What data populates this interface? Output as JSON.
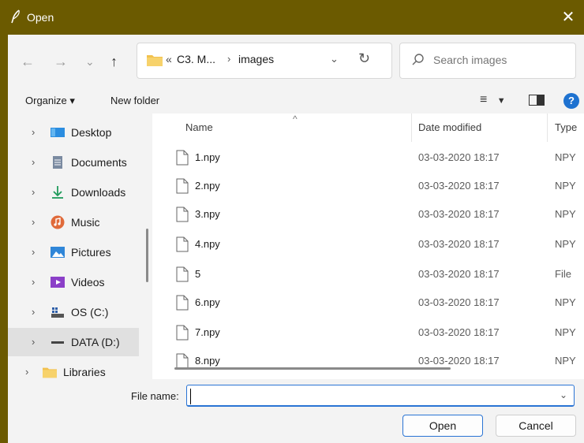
{
  "window": {
    "title": "Open"
  },
  "nav": {
    "back": "←",
    "forward": "→",
    "recent": "⌄",
    "up": "↑"
  },
  "address": {
    "prefix": "«",
    "segments": [
      "C3. M...",
      "images"
    ]
  },
  "search": {
    "placeholder": "Search images"
  },
  "toolbar": {
    "organize": "Organize ▾",
    "new_folder": "New folder"
  },
  "sidebar": {
    "items": [
      {
        "label": "Desktop",
        "icon": "desktop-icon",
        "color": "#2b8de0"
      },
      {
        "label": "Documents",
        "icon": "documents-icon",
        "color": "#7a8aa0"
      },
      {
        "label": "Downloads",
        "icon": "downloads-icon",
        "color": "#1f9a5a"
      },
      {
        "label": "Music",
        "icon": "music-icon",
        "color": "#e06a3a"
      },
      {
        "label": "Pictures",
        "icon": "pictures-icon",
        "color": "#2f86d8"
      },
      {
        "label": "Videos",
        "icon": "videos-icon",
        "color": "#8b3fc8"
      },
      {
        "label": "OS (C:)",
        "icon": "drive-c-icon",
        "color": "#2f5fa8"
      },
      {
        "label": "DATA (D:)",
        "icon": "drive-d-icon",
        "color": "#444444",
        "selected": true
      },
      {
        "label": "Libraries",
        "icon": "libraries-icon",
        "color": "#f2c14e"
      }
    ]
  },
  "files": {
    "columns": [
      "Name",
      "Date modified",
      "Type"
    ],
    "rows": [
      {
        "name": "1.npy",
        "date": "03-03-2020 18:17",
        "type": "NPY"
      },
      {
        "name": "2.npy",
        "date": "03-03-2020 18:17",
        "type": "NPY"
      },
      {
        "name": "3.npy",
        "date": "03-03-2020 18:17",
        "type": "NPY"
      },
      {
        "name": "4.npy",
        "date": "03-03-2020 18:17",
        "type": "NPY"
      },
      {
        "name": "5",
        "date": "03-03-2020 18:17",
        "type": "File"
      },
      {
        "name": "6.npy",
        "date": "03-03-2020 18:17",
        "type": "NPY"
      },
      {
        "name": "7.npy",
        "date": "03-03-2020 18:17",
        "type": "NPY"
      },
      {
        "name": "8.npy",
        "date": "03-03-2020 18:17",
        "type": "NPY"
      }
    ]
  },
  "bottom": {
    "file_name_label": "File name:",
    "file_name_value": "",
    "open": "Open",
    "cancel": "Cancel"
  },
  "colors": {
    "titlebar": "#6b5a00",
    "accent": "#2a74d4"
  }
}
